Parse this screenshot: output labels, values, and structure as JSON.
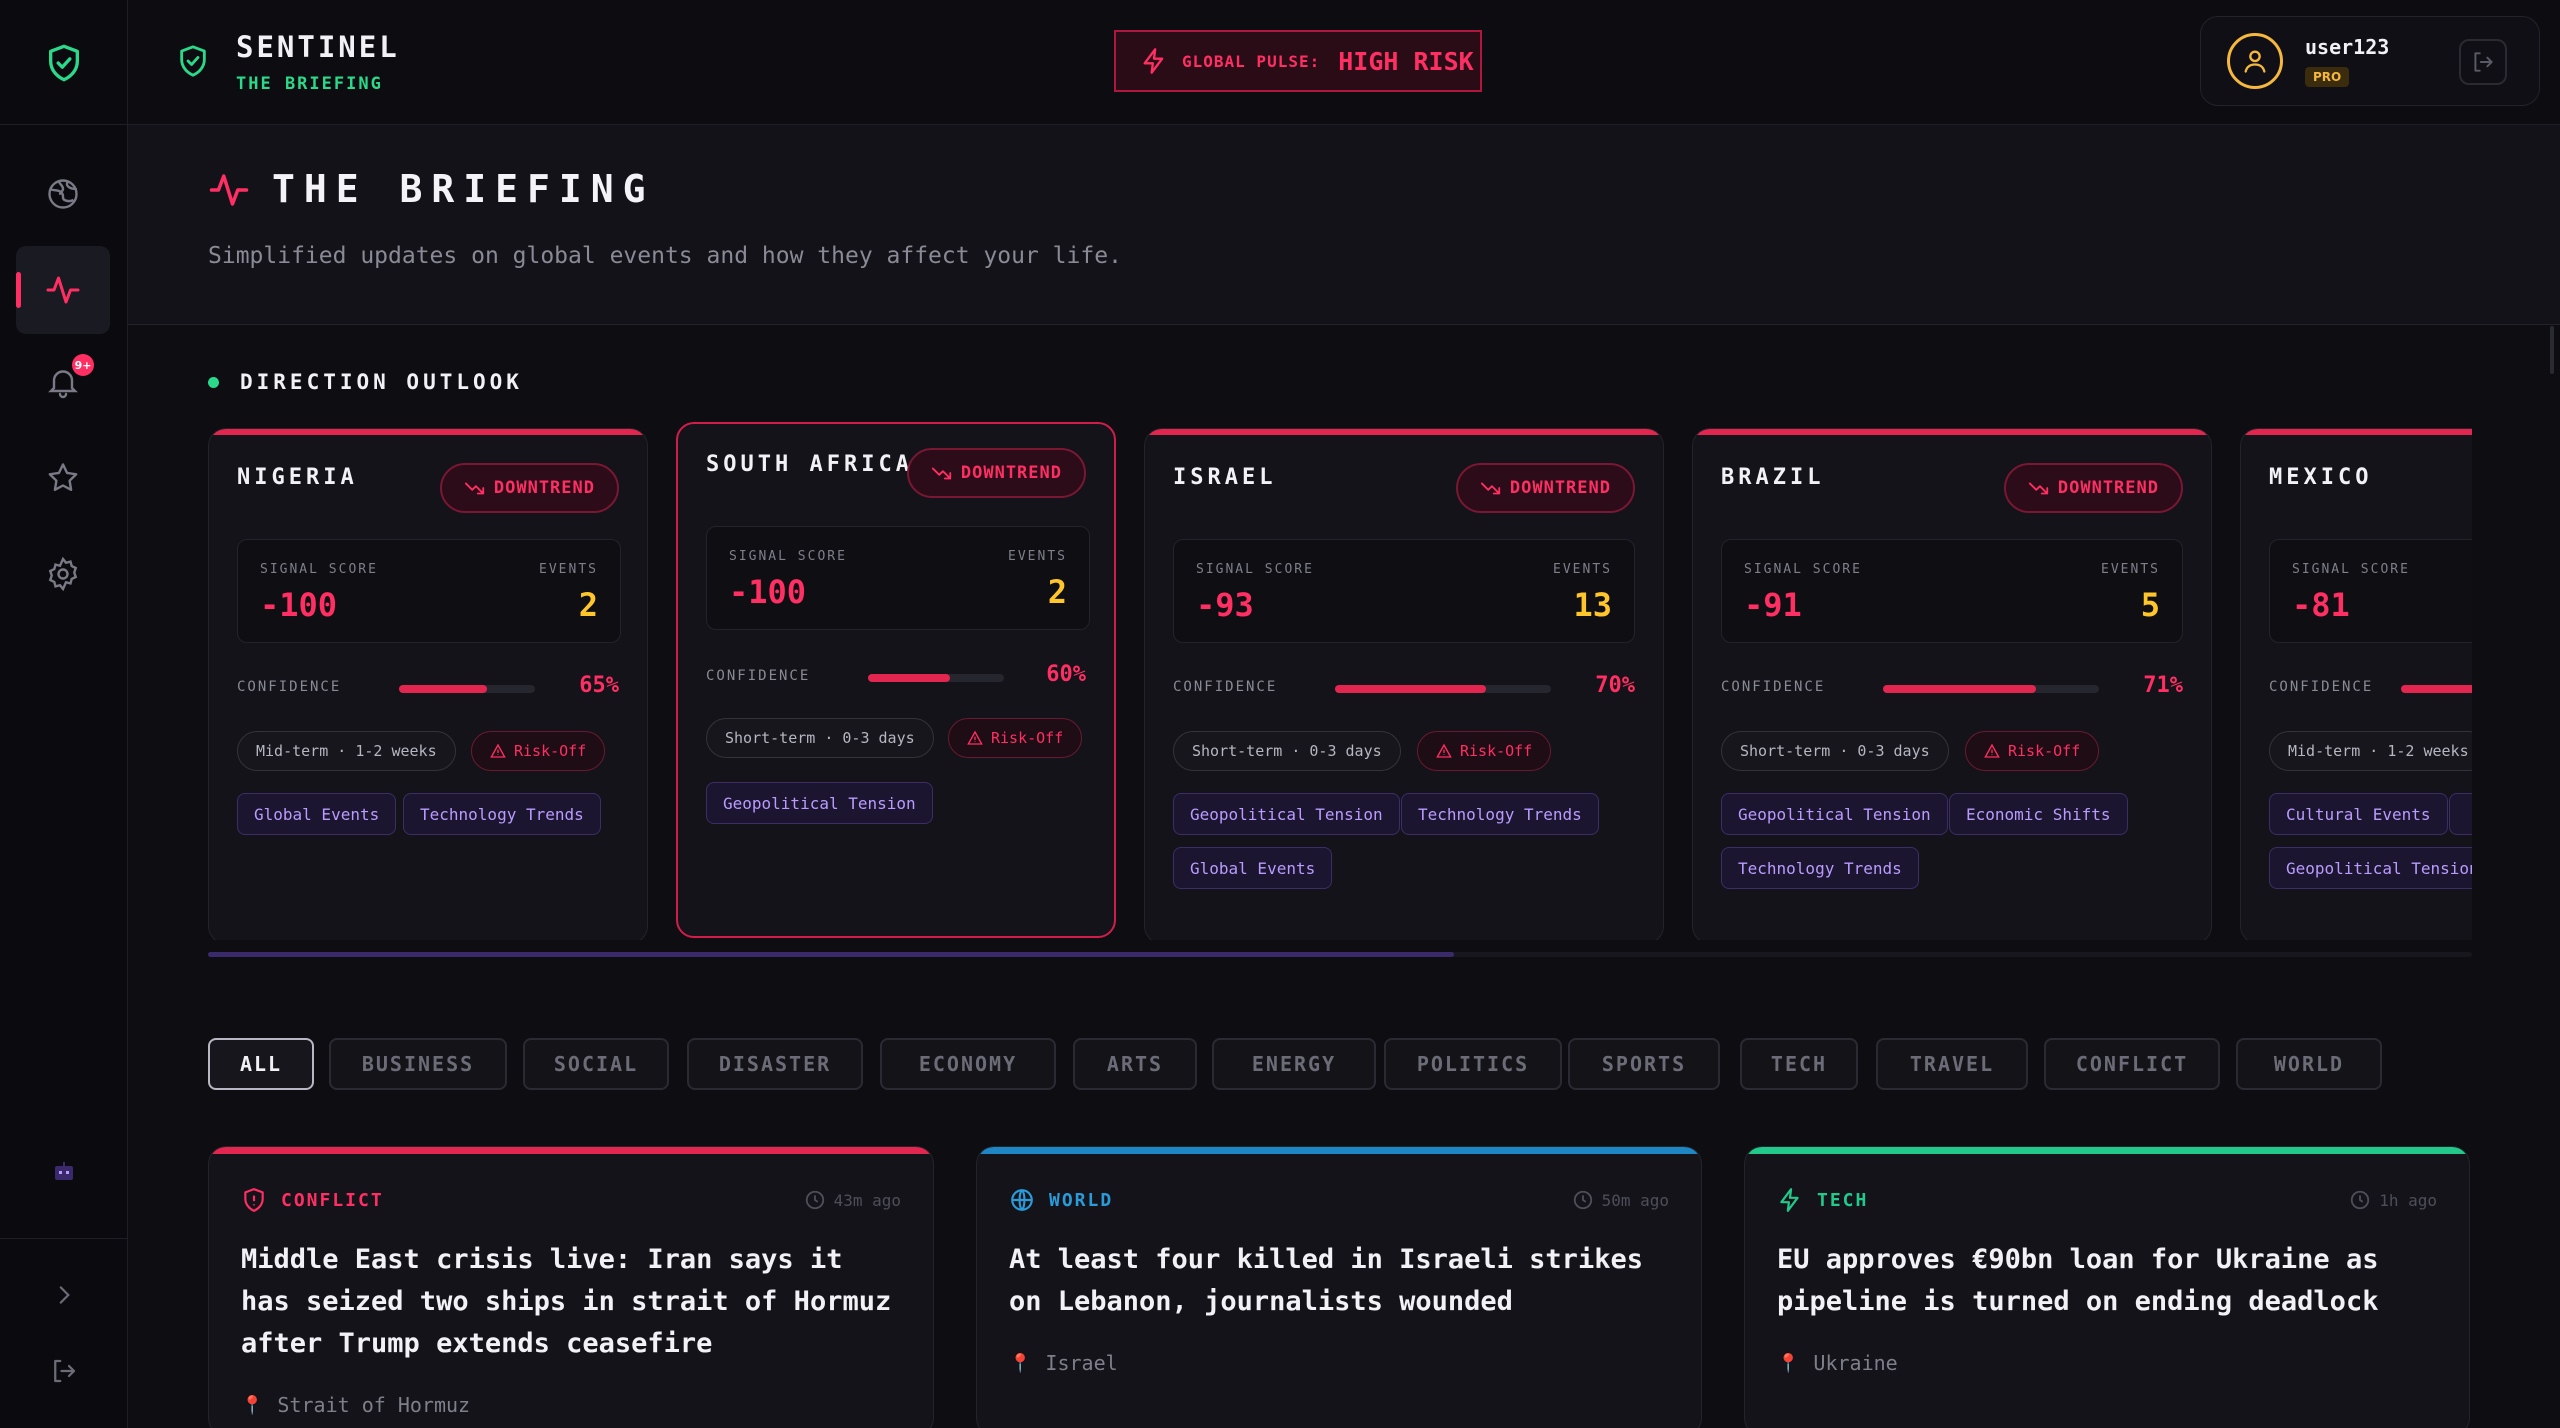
{
  "colors": {
    "accent": "#ff2e63",
    "brand_green": "#2bd98a",
    "warning": "#ffc62b",
    "tag_purple": "#b99bff",
    "world_blue": "#1f86c4",
    "tech_green": "#22c98a"
  },
  "sidebar": {
    "items": [
      {
        "icon": "globe-icon",
        "name": "nav-globe"
      },
      {
        "icon": "pulse-icon",
        "name": "nav-briefing",
        "active": true
      },
      {
        "icon": "bell-icon",
        "name": "nav-alerts",
        "badge": "9+"
      },
      {
        "icon": "star-icon",
        "name": "nav-favorites"
      },
      {
        "icon": "gear-icon",
        "name": "nav-settings"
      }
    ]
  },
  "topbar": {
    "brand_title": "SENTINEL",
    "brand_subtitle": "THE BRIEFING",
    "pulse_label": "GLOBAL PULSE:",
    "pulse_value": "HIGH RISK",
    "username": "user123",
    "plan": "PRO"
  },
  "header": {
    "title": "THE BRIEFING",
    "subtitle": "Simplified updates on global events and how they affect your life."
  },
  "outlook": {
    "section_title": "DIRECTION OUTLOOK",
    "score_label": "SIGNAL SCORE",
    "events_label": "EVENTS",
    "confidence_label": "CONFIDENCE",
    "risk_label": "Risk-Off",
    "trend_label": "DOWNTREND",
    "cards": [
      {
        "country": "NIGERIA",
        "score": "-100",
        "events": "2",
        "confidence": 0.65,
        "confidence_text": "65%",
        "term": "Mid-term · 1-2 weeks",
        "tags": [
          "Global Events",
          "Technology Trends"
        ]
      },
      {
        "country": "SOUTH AFRICA",
        "score": "-100",
        "events": "2",
        "confidence": 0.6,
        "confidence_text": "60%",
        "term": "Short-term · 0-3 days",
        "tags": [
          "Geopolitical Tension"
        ]
      },
      {
        "country": "ISRAEL",
        "score": "-93",
        "events": "13",
        "confidence": 0.7,
        "confidence_text": "70%",
        "term": "Short-term · 0-3 days",
        "tags": [
          "Geopolitical Tension",
          "Technology Trends",
          "Global Events"
        ]
      },
      {
        "country": "BRAZIL",
        "score": "-91",
        "events": "5",
        "confidence": 0.71,
        "confidence_text": "71%",
        "term": "Short-term · 0-3 days",
        "tags": [
          "Geopolitical Tension",
          "Economic Shifts",
          "Technology Trends"
        ]
      },
      {
        "country": "MEXICO",
        "score": "-81",
        "term": "Mid-term · 1-2 weeks",
        "tags": [
          "Cultural Events",
          "Geopolitical Tension"
        ]
      }
    ]
  },
  "filters": [
    "ALL",
    "BUSINESS",
    "SOCIAL",
    "DISASTER",
    "ECONOMY",
    "ARTS",
    "ENERGY",
    "POLITICS",
    "SPORTS",
    "TECH",
    "TRAVEL",
    "CONFLICT",
    "WORLD"
  ],
  "news": [
    {
      "category": "CONFLICT",
      "icon": "shield-alert-icon",
      "time": "43m ago",
      "title": "Middle East crisis live: Iran says it has seized two ships in strait of Hormuz after Trump extends ceasefire",
      "location": "Strait of Hormuz"
    },
    {
      "category": "WORLD",
      "icon": "globe-icon",
      "time": "50m ago",
      "title": "At least four killed in Israeli strikes on Lebanon, journalists wounded",
      "location": "Israel"
    },
    {
      "category": "TECH",
      "icon": "bolt-icon",
      "time": "1h ago",
      "title": "EU approves €90bn loan for Ukraine as pipeline is turned on ending deadlock",
      "location": "Ukraine"
    }
  ]
}
